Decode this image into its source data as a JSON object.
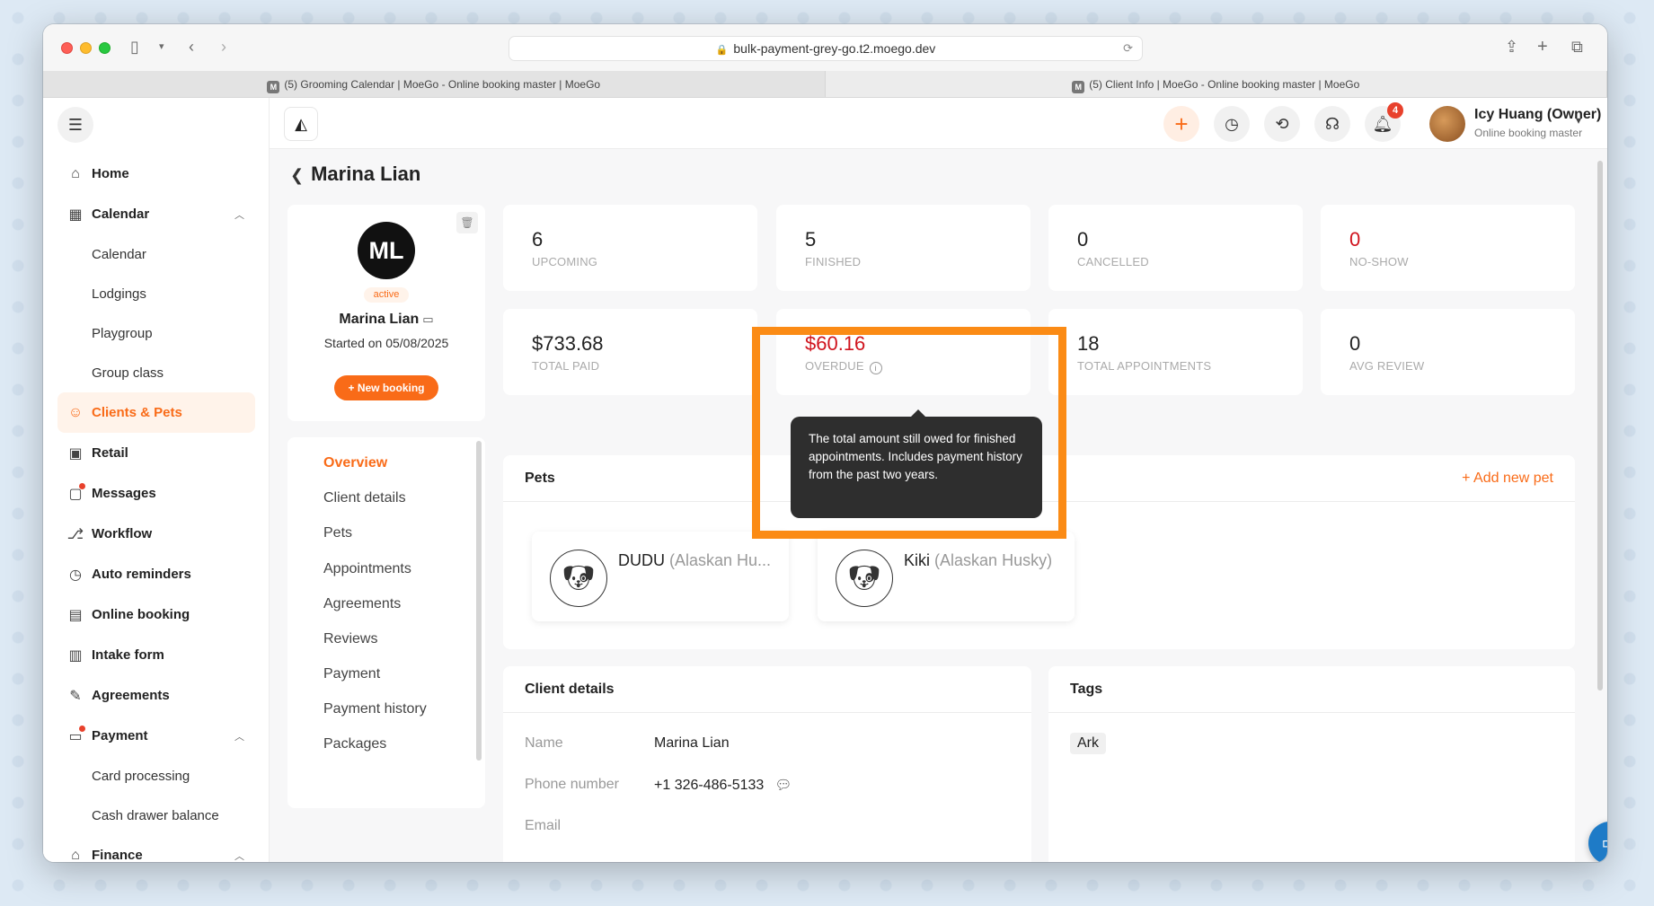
{
  "browser": {
    "url": "bulk-payment-grey-go.t2.moego.dev",
    "tabs": [
      {
        "label": "(5) Grooming Calendar | MoeGo - Online booking master | MoeGo",
        "favicon": "M"
      },
      {
        "label": "(5) Client Info | MoeGo - Online booking master | MoeGo",
        "favicon": "M"
      }
    ]
  },
  "sidebar": {
    "items": [
      {
        "label": "Home",
        "icon": "home-icon"
      },
      {
        "label": "Calendar",
        "icon": "calendar-icon"
      },
      {
        "label": "Calendar"
      },
      {
        "label": "Lodgings"
      },
      {
        "label": "Playgroup"
      },
      {
        "label": "Group class"
      },
      {
        "label": "Clients & Pets",
        "icon": "clients-icon"
      },
      {
        "label": "Retail",
        "icon": "retail-icon"
      },
      {
        "label": "Messages",
        "icon": "messages-icon"
      },
      {
        "label": "Workflow",
        "icon": "workflow-icon"
      },
      {
        "label": "Auto reminders",
        "icon": "reminder-icon"
      },
      {
        "label": "Online booking",
        "icon": "online-booking-icon"
      },
      {
        "label": "Intake form",
        "icon": "intake-form-icon"
      },
      {
        "label": "Agreements",
        "icon": "agreements-icon"
      },
      {
        "label": "Payment",
        "icon": "payment-icon"
      },
      {
        "label": "Card processing"
      },
      {
        "label": "Cash drawer balance"
      },
      {
        "label": "Finance",
        "icon": "finance-icon"
      }
    ]
  },
  "topbar": {
    "notification_count": "4",
    "user_name": "Icy Huang (Owner)",
    "user_subtitle": "Online booking master"
  },
  "page": {
    "title": "Marina Lian"
  },
  "profile": {
    "initials": "ML",
    "status": "active",
    "name": "Marina Lian",
    "started": "Started on 05/08/2025",
    "new_booking": "+ New booking"
  },
  "left_tabs": [
    "Overview",
    "Client details",
    "Pets",
    "Appointments",
    "Agreements",
    "Reviews",
    "Payment",
    "Payment history",
    "Packages"
  ],
  "stats": [
    {
      "value": "6",
      "label": "UPCOMING"
    },
    {
      "value": "5",
      "label": "FINISHED"
    },
    {
      "value": "0",
      "label": "CANCELLED"
    },
    {
      "value": "0",
      "label": "NO-SHOW"
    },
    {
      "value": "$733.68",
      "label": "TOTAL PAID"
    },
    {
      "value": "$60.16",
      "label": "OVERDUE"
    },
    {
      "value": "18",
      "label": "TOTAL APPOINTMENTS"
    },
    {
      "value": "0",
      "label": "AVG REVIEW"
    }
  ],
  "tooltip": {
    "text": "The total amount still owed for finished appointments. Includes payment history from the past two years."
  },
  "pets": {
    "title": "Pets",
    "add_label": "+ Add new pet",
    "list": [
      {
        "name": "DUDU",
        "breed": "(Alaskan Hu..."
      },
      {
        "name": "Kiki",
        "breed": "(Alaskan Husky)"
      }
    ]
  },
  "client_details": {
    "title": "Client details",
    "rows": [
      {
        "label": "Name",
        "value": "Marina Lian"
      },
      {
        "label": "Phone number",
        "value": "+1 326-486-5133"
      },
      {
        "label": "Email",
        "value": ""
      }
    ]
  },
  "tags": {
    "title": "Tags",
    "items": [
      "Ark"
    ]
  },
  "colors": {
    "accent": "#f96b18",
    "overdue": "#d0141e",
    "highlight": "#fb8b15"
  }
}
